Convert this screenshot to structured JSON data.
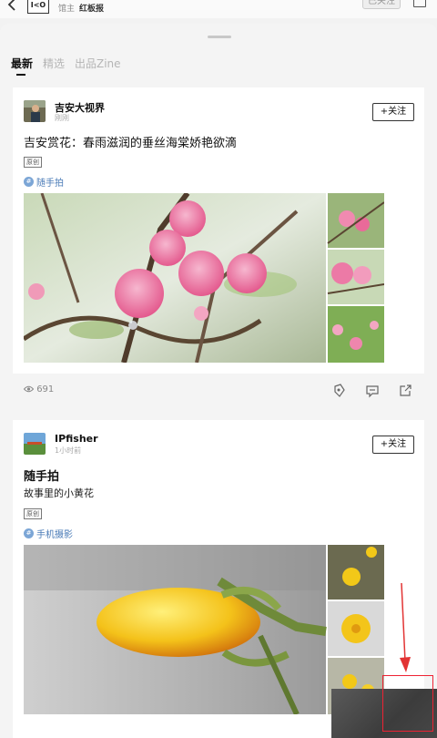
{
  "topbar": {
    "logo_text": "I<O",
    "host": "馆主",
    "channel": "红板报",
    "followed_label": "已关注"
  },
  "tabs": [
    {
      "label": "最新",
      "active": true
    },
    {
      "label": "精选",
      "active": false
    },
    {
      "label": "出品Zine",
      "active": false
    }
  ],
  "posts": [
    {
      "author": "吉安大视界",
      "time": "刚刚",
      "follow_label": "+关注",
      "title": "吉安赏花：春雨滋润的垂丝海棠娇艳欲滴",
      "tag": "原创",
      "topic": "随手拍",
      "views": "691"
    },
    {
      "author": "IPfisher",
      "time": "1小时前",
      "follow_label": "+关注",
      "title": "随手拍",
      "subtitle": "故事里的小黄花",
      "tag": "原创",
      "topic": "手机摄影"
    }
  ],
  "icons": {
    "views": "eye-icon",
    "like": "reward-icon",
    "comment": "comment-icon",
    "share": "share-icon"
  },
  "colors": {
    "accent_blue": "#4a7bb7",
    "annotation_red": "#e23333"
  }
}
